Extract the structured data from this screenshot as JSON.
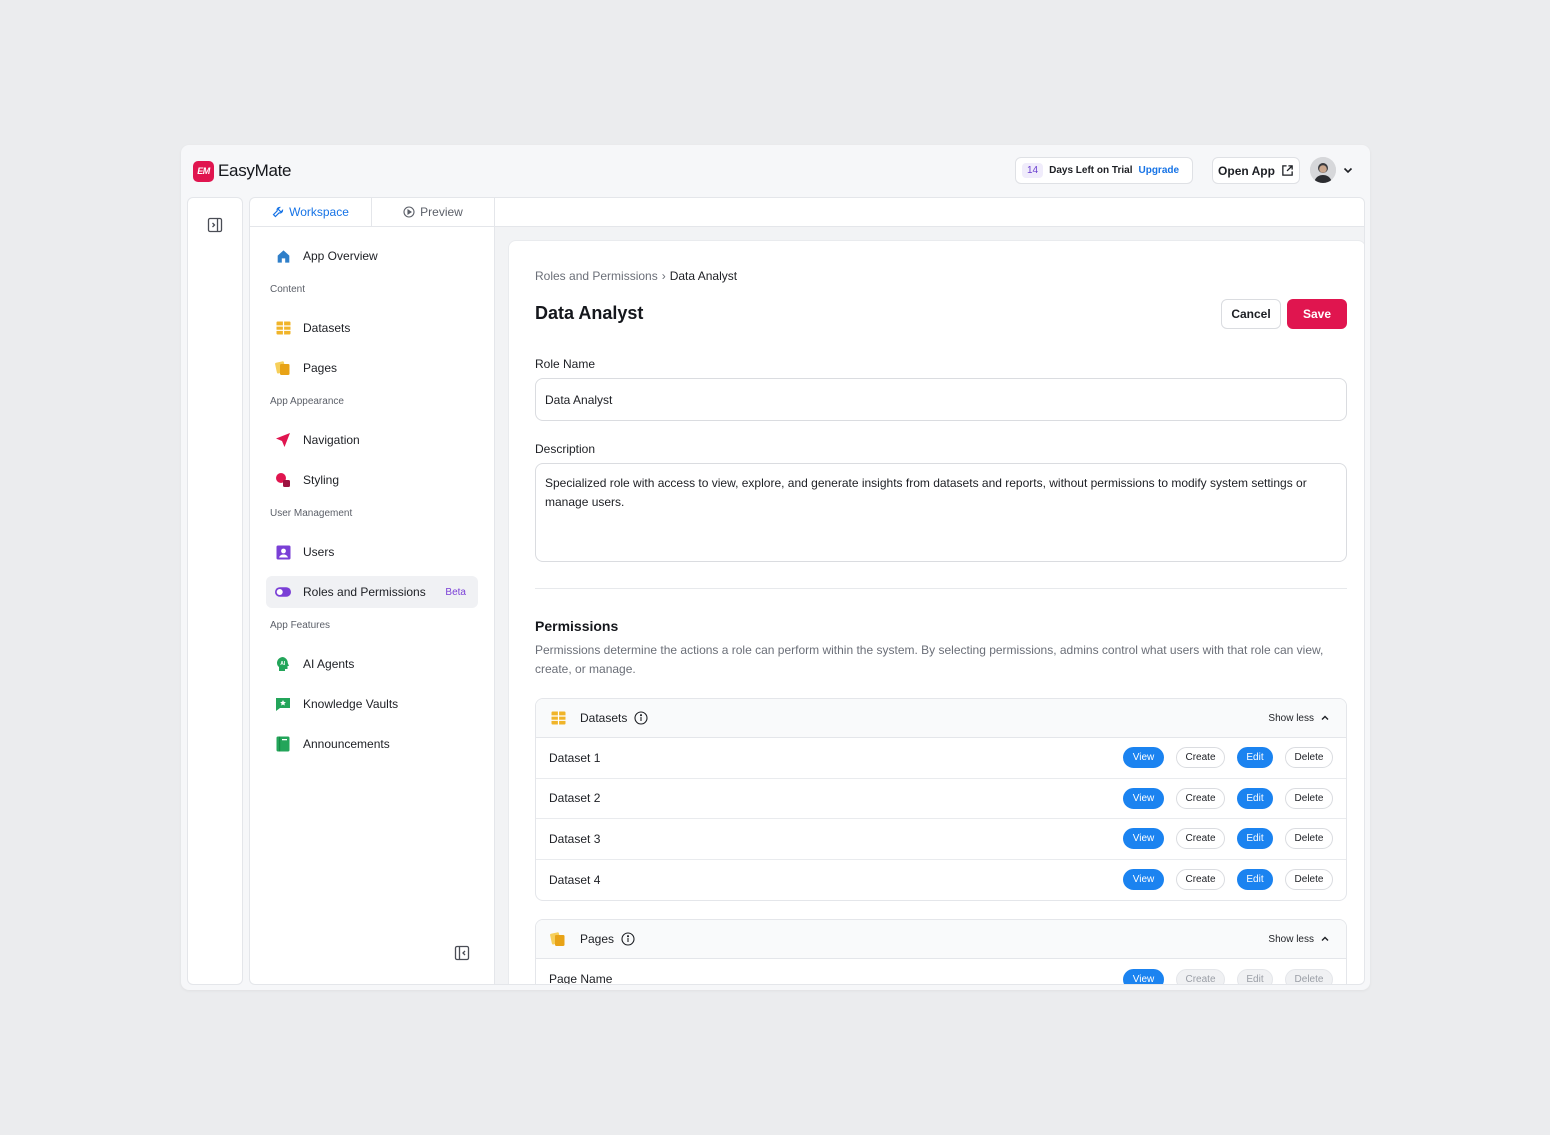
{
  "brand": {
    "logo_text": "EM",
    "name": "EasyMate"
  },
  "trial": {
    "days": "14",
    "text": "Days Left on Trial",
    "upgrade": "Upgrade"
  },
  "header": {
    "open_app": "Open App"
  },
  "tabs": {
    "workspace": "Workspace",
    "preview": "Preview"
  },
  "sidebar": {
    "app_overview": "App Overview",
    "sections": {
      "content": "Content",
      "appearance": "App Appearance",
      "user_management": "User Management",
      "features": "App Features"
    },
    "items": {
      "datasets": "Datasets",
      "pages": "Pages",
      "navigation": "Navigation",
      "styling": "Styling",
      "users": "Users",
      "roles": "Roles and Permissions",
      "roles_badge": "Beta",
      "ai_agents": "AI Agents",
      "knowledge_vaults": "Knowledge Vaults",
      "announcements": "Announcements"
    }
  },
  "main": {
    "breadcrumb": {
      "parent": "Roles and Permissions",
      "separator": "›",
      "current": "Data Analyst"
    },
    "title": "Data Analyst",
    "cancel": "Cancel",
    "save": "Save",
    "role_name_label": "Role Name",
    "role_name_value": "Data Analyst",
    "description_label": "Description",
    "description_value": "Specialized role with access to view, explore, and generate insights from datasets and reports, without permissions to modify system settings or manage users.",
    "permissions_title": "Permissions",
    "permissions_desc": "Permissions determine the actions a role can perform within the system. By selecting permissions, admins control what users with that role can view, create, or manage."
  },
  "chip_labels": {
    "view": "View",
    "create": "Create",
    "edit": "Edit",
    "delete": "Delete"
  },
  "groups": {
    "datasets": {
      "title": "Datasets",
      "show_less": "Show less",
      "rows": [
        {
          "name": "Dataset 1",
          "view": true,
          "create": false,
          "edit": true,
          "delete": false
        },
        {
          "name": "Dataset 2",
          "view": true,
          "create": false,
          "edit": true,
          "delete": false
        },
        {
          "name": "Dataset 3",
          "view": true,
          "create": false,
          "edit": true,
          "delete": false
        },
        {
          "name": "Dataset 4",
          "view": true,
          "create": false,
          "edit": true,
          "delete": false
        }
      ]
    },
    "pages": {
      "title": "Pages",
      "show_less": "Show less",
      "rows": [
        {
          "name": "Page Name",
          "view": true,
          "create": false,
          "edit": false,
          "delete": false
        }
      ]
    }
  },
  "colors": {
    "brand": "#e0154f",
    "accent": "#1b83f0",
    "badge": "#7a3fd6"
  }
}
